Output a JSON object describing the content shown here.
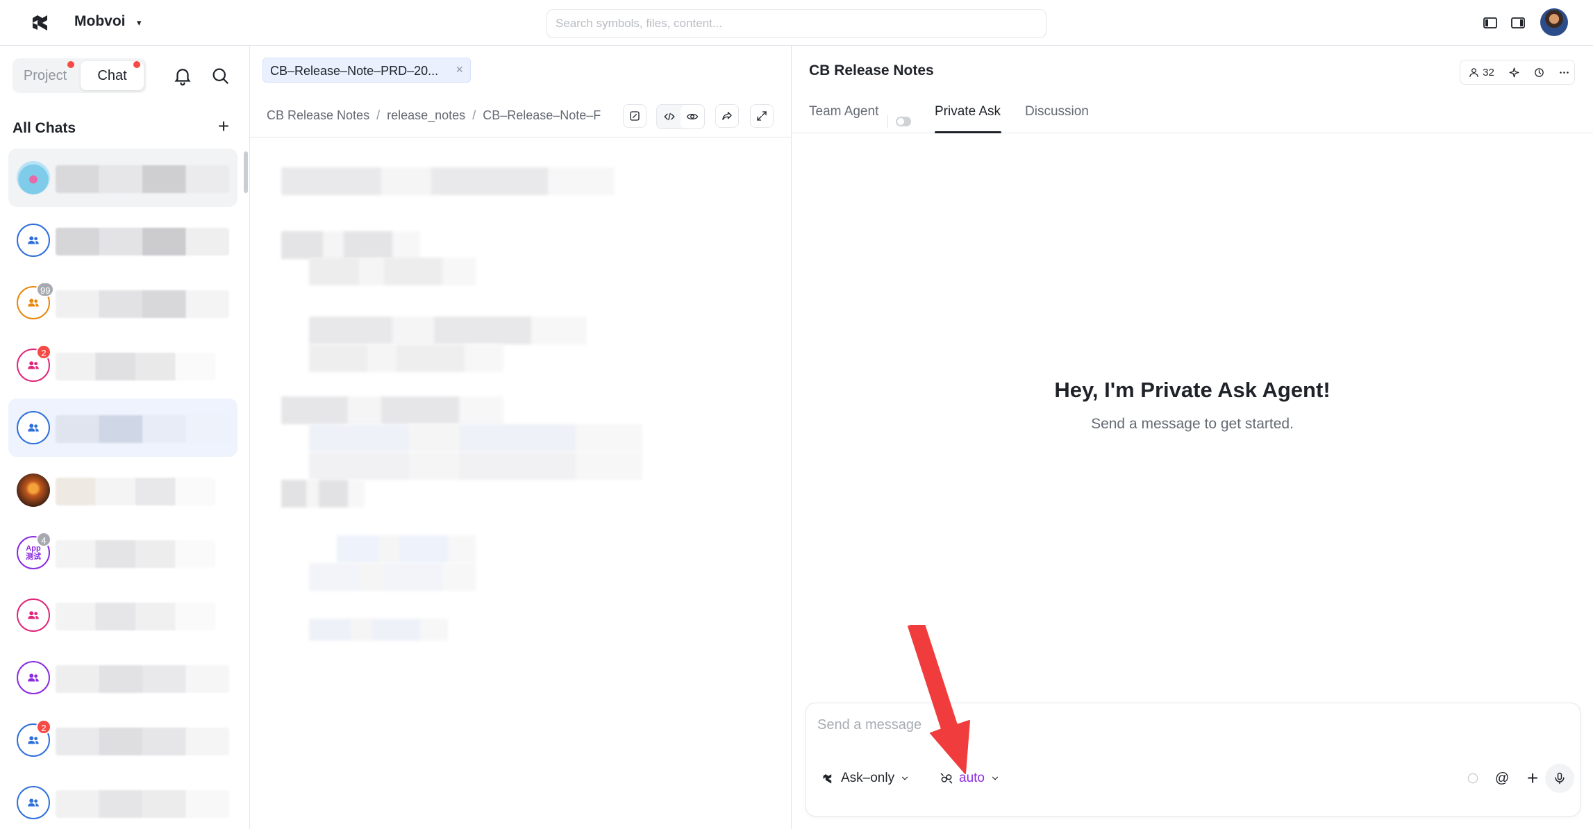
{
  "topbar": {
    "org_name": "Mobvoi",
    "org_caret": "▾",
    "search_placeholder": "Search symbols, files, content..."
  },
  "sidebar": {
    "tabs": {
      "project": "Project",
      "chat": "Chat"
    },
    "section_title": "All Chats",
    "add_label": "+",
    "chats": [
      {
        "avatar_type": "photo",
        "avatar_icon": "profile-photo",
        "badge": ""
      },
      {
        "avatar_type": "group",
        "color": "#2f6fdb",
        "avatar_icon": "group-icon",
        "badge": ""
      },
      {
        "avatar_type": "group",
        "color": "#e8870c",
        "avatar_icon": "group-icon",
        "badge": "99",
        "badge_style": "grey"
      },
      {
        "avatar_type": "group",
        "color": "#e0267a",
        "avatar_icon": "group-icon",
        "badge": "2",
        "badge_style": "red"
      },
      {
        "avatar_type": "group",
        "color": "#2f6fdb",
        "avatar_icon": "group-icon",
        "badge": ""
      },
      {
        "avatar_type": "photo",
        "avatar_icon": "sunset-photo",
        "badge": ""
      },
      {
        "avatar_type": "app",
        "color": "#8a2be2",
        "app_label_1": "App",
        "app_label_2": "测试",
        "badge": "4",
        "badge_style": "grey"
      },
      {
        "avatar_type": "group",
        "color": "#e0267a",
        "avatar_icon": "group-icon",
        "badge": ""
      },
      {
        "avatar_type": "group",
        "color": "#8a2be2",
        "avatar_icon": "group-icon",
        "badge": ""
      },
      {
        "avatar_type": "group",
        "color": "#2f6fdb",
        "avatar_icon": "group-icon",
        "badge": "2",
        "badge_style": "red"
      },
      {
        "avatar_type": "group",
        "color": "#2f6fdb",
        "avatar_icon": "group-icon",
        "badge": ""
      }
    ]
  },
  "middle": {
    "file_tab": "CB–Release–Note–PRD–20...",
    "file_tab_close": "×",
    "breadcrumb": [
      "CB Release Notes",
      "release_notes",
      "CB–Release–Note–F"
    ],
    "breadcrumb_sep": "/"
  },
  "right": {
    "title": "CB Release Notes",
    "member_count": "32",
    "tabs": [
      "Team Agent",
      "Private Ask",
      "Discussion"
    ],
    "active_tab": "Private Ask",
    "empty_title": "Hey, I'm Private Ask Agent!",
    "empty_subtitle": "Send a message to get started.",
    "composer": {
      "placeholder": "Send a message",
      "mode_label": "Ask–only",
      "model_label": "auto",
      "at_label": "@",
      "plus_label": "+"
    }
  },
  "colors": {
    "accent_purple": "#8a2be2",
    "badge_red": "#f54a45",
    "annotation_red": "#f03c3c",
    "selected_bg": "#eef3fd"
  }
}
